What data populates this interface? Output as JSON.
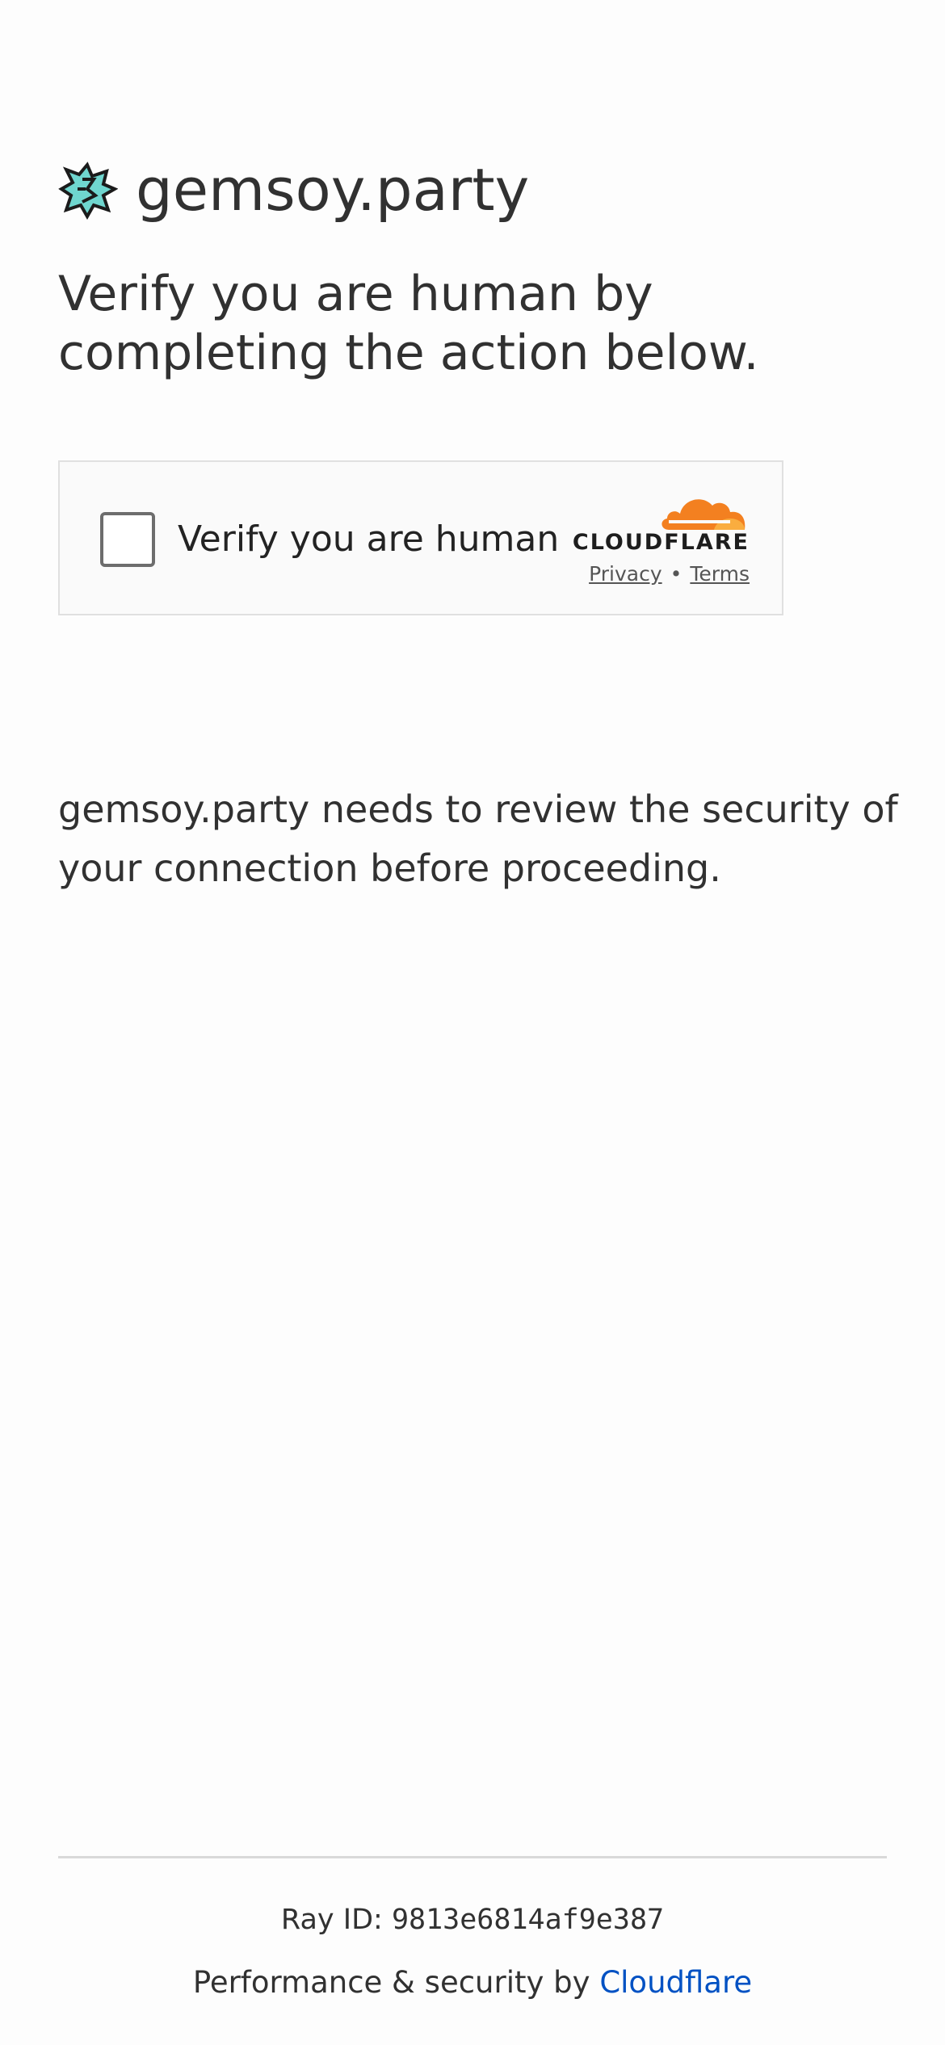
{
  "site": {
    "name": "gemsoy.party",
    "icon": "site-favicon-icon"
  },
  "headline": "Verify you are human by completing the action below.",
  "challenge": {
    "checkbox_label": "Verify you are human",
    "checked": false,
    "brand": "CLOUDFLARE",
    "privacy_label": "Privacy",
    "separator": "•",
    "terms_label": "Terms",
    "brand_color": "#f38020"
  },
  "description": "gemsoy.party needs to review the security of your connection before proceeding.",
  "footer": {
    "ray_label": "Ray ID: ",
    "ray_id": "9813e6814af9e387",
    "performance_label": "Performance & security by ",
    "cloudflare_link": "Cloudflare",
    "link_color": "#0051c3"
  }
}
